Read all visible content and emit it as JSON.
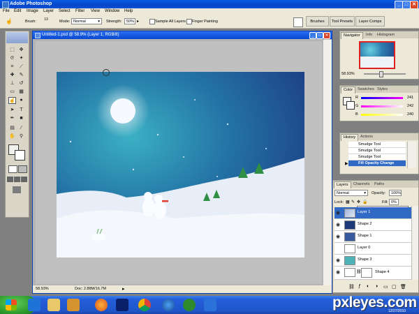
{
  "app": {
    "title": "Adobe Photoshop"
  },
  "menu": [
    "File",
    "Edit",
    "Image",
    "Layer",
    "Select",
    "Filter",
    "View",
    "Window",
    "Help"
  ],
  "options": {
    "brush_label": "Brush:",
    "brush_size": "13",
    "mode_label": "Mode:",
    "mode_value": "Normal",
    "strength_label": "Strength:",
    "strength_value": "50%",
    "sample_all": "Sample All Layers",
    "finger_painting": "Finger Painting"
  },
  "well_tabs": [
    "Brushes",
    "Tool Presets",
    "Layer Comps"
  ],
  "document": {
    "title": "Untitled-1.psd @ 58.9% (Layer 1, RGB/8)",
    "zoom": "58.93%",
    "doc_size": "Doc: 2.88M/16.7M"
  },
  "navigator": {
    "tabs": [
      "Navigator",
      "Info",
      "Histogram"
    ],
    "zoom": "58.93%"
  },
  "color": {
    "tabs": [
      "Color",
      "Swatches",
      "Styles"
    ],
    "channels": [
      {
        "label": "R",
        "value": "241"
      },
      {
        "label": "G",
        "value": "242"
      },
      {
        "label": "B",
        "value": "240"
      }
    ]
  },
  "history": {
    "tabs": [
      "History",
      "Actions"
    ],
    "items": [
      {
        "label": "Smudge Tool",
        "selected": false
      },
      {
        "label": "Smudge Tool",
        "selected": false
      },
      {
        "label": "Smudge Tool",
        "selected": false
      },
      {
        "label": "Fill Opacity Change",
        "selected": true
      }
    ]
  },
  "layers": {
    "tabs": [
      "Layers",
      "Channels",
      "Paths"
    ],
    "blend_mode": "Normal",
    "opacity_label": "Opacity:",
    "opacity": "100%",
    "lock_label": "Lock:",
    "fill_label": "Fill:",
    "fill": "0%",
    "items": [
      {
        "name": "Layer 1",
        "selected": true,
        "color": "#9fb4d8"
      },
      {
        "name": "Shape 2",
        "selected": false,
        "color": "#1e3a78"
      },
      {
        "name": "Shape 1",
        "selected": false,
        "color": "#3a5aa0"
      },
      {
        "name": "Layer 0",
        "selected": false,
        "color": "#ffffff"
      },
      {
        "name": "Shape 3",
        "selected": false,
        "color": "#4fb2b6"
      },
      {
        "name": "Shape 4",
        "selected": false,
        "color": "#ffffff"
      }
    ]
  },
  "taskbar": {
    "watermark": "pxleyes.com",
    "date": "12/27/2010"
  },
  "colors": {
    "titlebar": "#0a4fd6",
    "selection": "#316ac5",
    "sky_top": "#1f3f8f",
    "sky_glow": "#2e8fb0"
  }
}
